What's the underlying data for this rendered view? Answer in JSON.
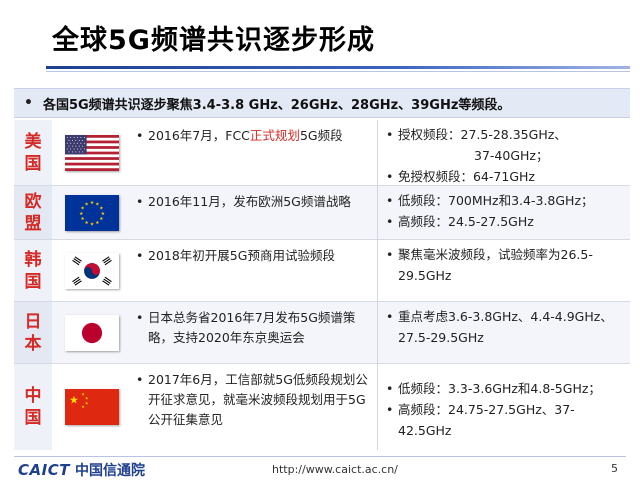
{
  "header": {
    "title": "全球5G频谱共识逐步形成"
  },
  "summary": {
    "bullet": "•",
    "text": "各国5G频谱共识逐步聚焦3.4-3.8 GHz、26GHz、28GHz、39GHz等频段。"
  },
  "rows": [
    {
      "country_chars": [
        "美",
        "国"
      ],
      "flag": "us-flag-icon",
      "mid": {
        "pre": "2016年7月，FCC",
        "highlight": "正式规划",
        "post": "5G频段"
      },
      "right": [
        "授权频段：27.5-28.35GHz、",
        "37-40GHz；",
        "免授权频段：64-71GHz"
      ]
    },
    {
      "country_chars": [
        "欧",
        "盟"
      ],
      "flag": "eu-flag-icon",
      "mid": {
        "text": "2016年11月，发布欧洲5G频谱战略"
      },
      "right": [
        "低频段：700MHz和3.4-3.8GHz；",
        "高频段：24.5-27.5GHz"
      ]
    },
    {
      "country_chars": [
        "韩",
        "国"
      ],
      "flag": "kr-flag-icon",
      "mid": {
        "text": "2018年初开展5G预商用试验频段"
      },
      "right": [
        "聚焦毫米波频段，试验频率为26.5-29.5GHz"
      ]
    },
    {
      "country_chars": [
        "日",
        "本"
      ],
      "flag": "jp-flag-icon",
      "mid": {
        "text": "日本总务省2016年7月发布5G频谱策略，支持2020年东京奥运会"
      },
      "right": [
        "重点考虑3.6-3.8GHz、4.4-4.9GHz、27.5-29.5GHz"
      ]
    },
    {
      "country_chars": [
        "中",
        "国"
      ],
      "flag": "cn-flag-icon",
      "mid": {
        "text": "2017年6月，工信部就5G低频段规划公开征求意见，就毫米波频段规划用于5G公开征集意见"
      },
      "right": [
        "低频段：3.3-3.6GHz和4.8-5GHz；",
        "高频段：24.75-27.5GHz、37-42.5GHz"
      ]
    }
  ],
  "footer": {
    "logo_en": "CAICT",
    "logo_cn": "中国信通院",
    "url": "http://www.caict.ac.cn/",
    "page_number": "5"
  },
  "colors": {
    "accent_blue": "#1f3f8f",
    "country_red": "#d42b27",
    "summary_bg": "#e3eaf6"
  }
}
